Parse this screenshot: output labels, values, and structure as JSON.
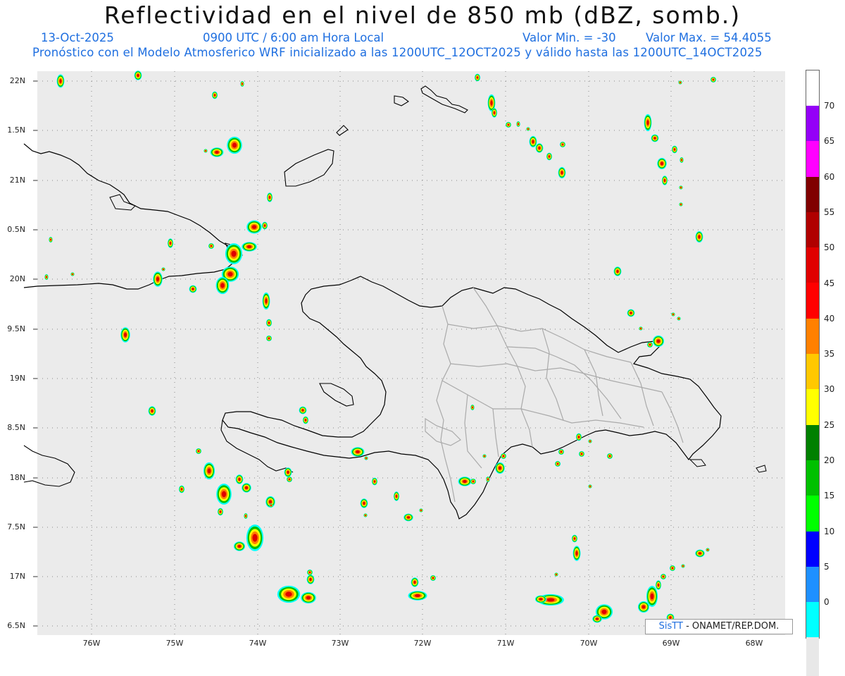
{
  "header": {
    "title": "Reflectividad en el nivel de 850 mb (dBZ, somb.)",
    "date": "13-Oct-2025",
    "time": "0900 UTC / 6:00 am Hora Local",
    "min_label": "Valor Min. = -30",
    "max_label": "Valor Max. = 54.4055",
    "forecast": "Pronóstico con el Modelo Atmosferico WRF inicializado a las 1200UTC_12OCT2025 y válido hasta las  1200UTC_14OCT2025"
  },
  "map": {
    "lon_range": [
      -76.65,
      -67.65
    ],
    "lat_range": [
      6.45,
      22.1
    ],
    "x_ticks": [
      "76W",
      "75W",
      "74W",
      "73W",
      "72W",
      "71W",
      "70W",
      "69W",
      "68W"
    ],
    "y_ticks": [
      "22N",
      "1.5N",
      "21N",
      "0.5N",
      "20N",
      "9.5N",
      "19N",
      "8.5N",
      "18N",
      "7.5N",
      "17N",
      "6.5N"
    ],
    "colors": {
      "land_background": "#ebebeb",
      "coastline": "#000000",
      "provinces": "#aaaaaa",
      "grid": "#888888"
    }
  },
  "colorbar": {
    "labels": [
      "70",
      "65",
      "60",
      "55",
      "50",
      "45",
      "40",
      "35",
      "30",
      "25",
      "20",
      "15",
      "10",
      "5",
      "0"
    ],
    "colors": [
      "#9400f7",
      "#ff00ff",
      "#800000",
      "#b00000",
      "#e00000",
      "#ff0000",
      "#ff8000",
      "#ffc800",
      "#ffff00",
      "#008000",
      "#00c000",
      "#00ff00",
      "#0000ff",
      "#1e90ff",
      "#00ffff",
      "#e8e8e8"
    ]
  },
  "footer": {
    "brand": "SisTT",
    "org": "- ONAMET/REP.DOM."
  }
}
